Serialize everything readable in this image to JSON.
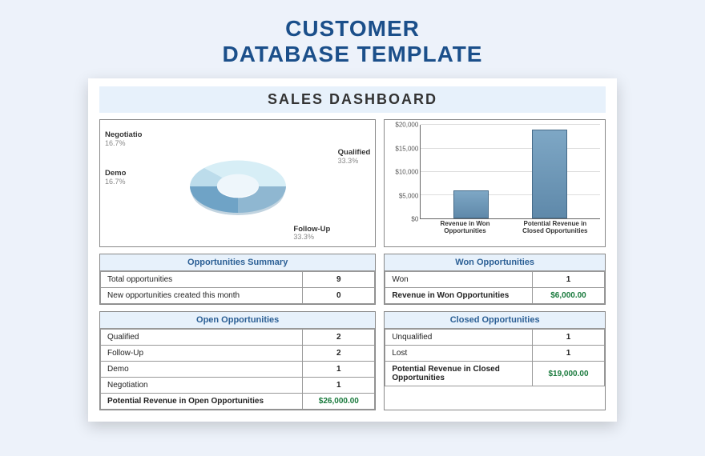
{
  "page_title_line1": "CUSTOMER",
  "page_title_line2": "DATABASE TEMPLATE",
  "dashboard_title": "SALES DASHBOARD",
  "donut": {
    "labels": {
      "negotiation": {
        "name": "Negotiatio",
        "pct": "16.7%"
      },
      "demo": {
        "name": "Demo",
        "pct": "16.7%"
      },
      "qualified": {
        "name": "Qualified",
        "pct": "33.3%"
      },
      "followup": {
        "name": "Follow-Up",
        "pct": "33.3%"
      }
    }
  },
  "bar": {
    "ticks": [
      "$20,000",
      "$15,000",
      "$10,000",
      "$5,000",
      "$0"
    ],
    "x": [
      "Revenue in Won Opportunities",
      "Potential Revenue in Closed Opportunities"
    ]
  },
  "tables": {
    "opp_summary": {
      "title": "Opportunities Summary",
      "rows": [
        {
          "label": "Total opportunities",
          "value": "9"
        },
        {
          "label": "New opportunities created this month",
          "value": "0"
        }
      ]
    },
    "won": {
      "title": "Won Opportunities",
      "rows": [
        {
          "label": "Won",
          "value": "1"
        }
      ],
      "total": {
        "label": "Revenue in Won Opportunities",
        "value": "$6,000.00"
      }
    },
    "open": {
      "title": "Open Opportunities",
      "rows": [
        {
          "label": "Qualified",
          "value": "2"
        },
        {
          "label": "Follow-Up",
          "value": "2"
        },
        {
          "label": "Demo",
          "value": "1"
        },
        {
          "label": "Negotiation",
          "value": "1"
        }
      ],
      "total": {
        "label": "Potential Revenue in Open Opportunities",
        "value": "$26,000.00"
      }
    },
    "closed": {
      "title": "Closed Opportunities",
      "rows": [
        {
          "label": "Unqualified",
          "value": "1"
        },
        {
          "label": "Lost",
          "value": "1"
        }
      ],
      "total": {
        "label": "Potential Revenue in Closed Opportunities",
        "value": "$19,000.00"
      }
    }
  },
  "chart_data": [
    {
      "type": "pie",
      "title": "Opportunity Stage Share",
      "series": [
        {
          "name": "Qualified",
          "value": 33.3
        },
        {
          "name": "Follow-Up",
          "value": 33.3
        },
        {
          "name": "Demo",
          "value": 16.7
        },
        {
          "name": "Negotiation",
          "value": 16.7
        }
      ]
    },
    {
      "type": "bar",
      "title": "Revenue Comparison",
      "categories": [
        "Revenue in Won Opportunities",
        "Potential Revenue in Closed Opportunities"
      ],
      "values": [
        6000,
        19000
      ],
      "ylabel": "USD",
      "ylim": [
        0,
        20000
      ]
    }
  ]
}
